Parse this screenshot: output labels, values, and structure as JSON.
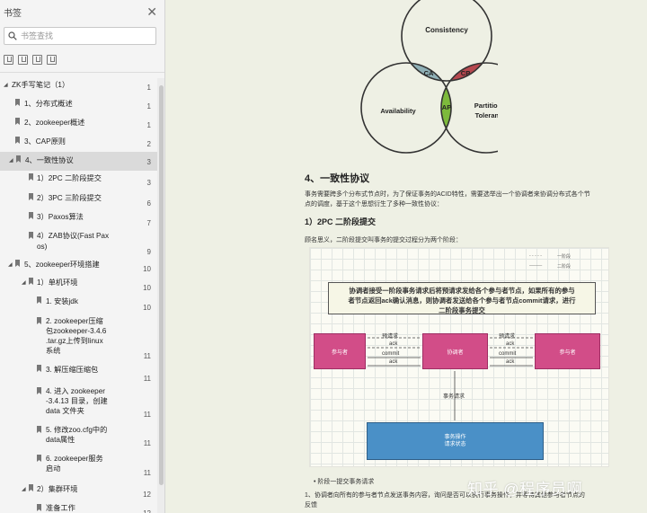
{
  "sidebar": {
    "title": "书签",
    "close_glyph": "✕",
    "search_placeholder": "书签查找",
    "icons": [
      "expand-bookmark-icon",
      "collapse-bookmark-icon",
      "add-bookmark-icon",
      "bookmark-options-icon"
    ],
    "items": [
      {
        "label": "ZK手写笔记（1）",
        "page": "1",
        "toggle": "◢"
      },
      {
        "label": "1、分布式概述",
        "page": "1"
      },
      {
        "label": "2、zookeeper概述",
        "page": "1"
      },
      {
        "label": "3、CAP原则",
        "page": "2"
      },
      {
        "label": "4、一致性协议",
        "page": "3",
        "toggle": "◢",
        "selected": true
      },
      {
        "label": "1）2PC 二阶段提交",
        "page": "3"
      },
      {
        "label": "2）3PC 三阶段提交",
        "page": "6"
      },
      {
        "label": "3）Paxos算法",
        "page": "7"
      },
      {
        "label": "4）ZAB协议(Fast Pax",
        "label2": "os)",
        "page": "9"
      },
      {
        "label": "5、zookeeper环境搭建",
        "page": "10",
        "toggle": "◢"
      },
      {
        "label": "1）单机环境",
        "page": "10",
        "toggle": "◢"
      },
      {
        "label": "1. 安装jdk",
        "page": "10"
      },
      {
        "label": "2. zookeeper压缩",
        "label2": "包zookeeper-3.4.6",
        "label3": ".tar.gz上传到linux",
        "label4": "系统",
        "page": "11"
      },
      {
        "label": "3. 解压缩压缩包",
        "page": "11"
      },
      {
        "label": "4. 进入 zookeeper",
        "label2": "-3.4.13 目录，创建",
        "label3": "data 文件夹",
        "page": "11"
      },
      {
        "label": "5. 修改zoo.cfg中的",
        "label2": "data属性",
        "page": "11"
      },
      {
        "label": "6. zookeeper服务",
        "label2": "启动",
        "page": "11"
      },
      {
        "label": "2）集群环境",
        "page": "12",
        "toggle": "◢"
      },
      {
        "label": "准备工作",
        "page": "12"
      }
    ]
  },
  "doc": {
    "venn": {
      "consistency": "Consistency",
      "availability": "Availability",
      "partition": "Partition",
      "tolerance": "Tolerance",
      "ca": "CA",
      "cp": "CP",
      "ap": "AP"
    },
    "section_title": "4、一致性协议",
    "section_para_1": "事务需要跨多个分布式节点时，为了保证事务的ACID特性，需要选举出一个协调者来协调分布式各个节",
    "section_para_2": "点的调度，基于这个思想衍生了多种一致性协议：",
    "sub_title": "1）2PC 二阶段提交",
    "sub_para": "顾名思义，二阶段提交叫事务的提交过程分为两个阶段：",
    "diagram": {
      "legend_1": "一阶段",
      "legend_2": "二阶段",
      "note_1": "协调者接受一阶段事务请求后将预请求发给各个参与者节点，如果所有的参与",
      "note_2": "者节点返回ack确认消息，则协调者发送给各个参与者节点commit请求，进行",
      "note_3": "二阶段事务提交",
      "participant_left": "参与者",
      "coordinator": "协调者",
      "participant_right": "参与者",
      "prepare": "预请求",
      "ack": "ack",
      "commit": "commit",
      "tx_request": "事务请求",
      "db_1": "事务操作",
      "db_2": "请求状态"
    },
    "bullet_1": "阶段一提交事务请求",
    "para_3a": "1、协调者向所有的参与者节点发送事务内容，询问是否可以执行事务操作，并等待其他参与者节点的",
    "para_3b": "反馈"
  },
  "watermark": "知乎 @程序员啊"
}
